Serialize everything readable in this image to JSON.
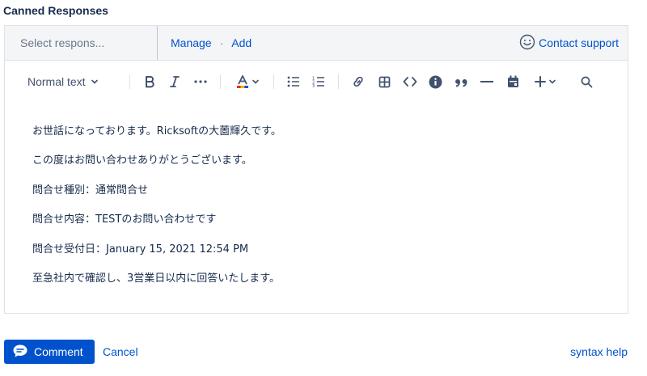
{
  "section_title": "Canned Responses",
  "canned": {
    "select_placeholder": "Select respons...",
    "manage_label": "Manage",
    "separator": "·",
    "add_label": "Add",
    "contact_label": "Contact support"
  },
  "toolbar": {
    "text_style": "Normal text",
    "icons": [
      "bold-icon",
      "italic-icon",
      "more-formatting-icon",
      "text-color-icon",
      "bullet-list-icon",
      "numbered-list-icon",
      "link-icon",
      "table-icon",
      "code-icon",
      "info-icon",
      "quote-icon",
      "divider-icon",
      "date-icon",
      "insert-plus-icon",
      "search-icon"
    ]
  },
  "content": {
    "lines": [
      "お世話になっております。Ricksoftの大薗輝久です。",
      "この度はお問い合わせありがとうございます。",
      "問合せ種別：通常問合せ",
      "問合せ内容：TESTのお問い合わせです",
      "問合せ受付日：January 15, 2021 12:54 PM",
      "至急社内で確認し、3営業日以内に回答いたします。"
    ]
  },
  "actions": {
    "comment_label": "Comment",
    "cancel_label": "Cancel",
    "syntax_help_label": "syntax help"
  },
  "colors": {
    "link": "#0052cc",
    "primary_button": "#0052cc",
    "text": "#172b4d",
    "toolbar_icon": "#42526e"
  }
}
